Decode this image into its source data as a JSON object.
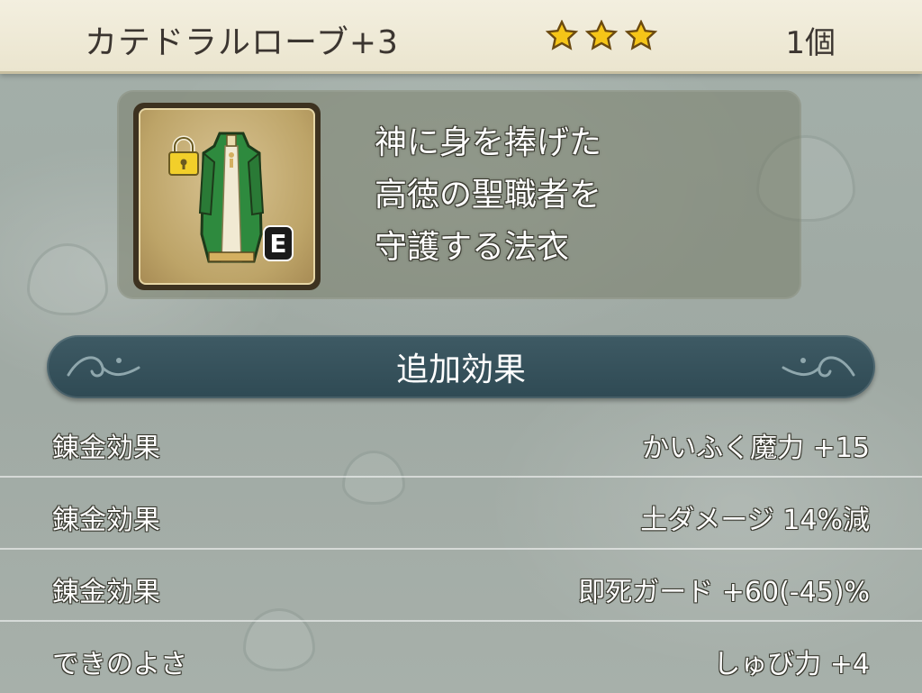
{
  "header": {
    "item_name": "カテドラルローブ+3",
    "stars": 3,
    "count": "1個"
  },
  "item": {
    "icon": "green-robe-icon",
    "locked": true,
    "equipped_badge": "E",
    "description": [
      "神に身を捧げた",
      "高徳の聖職者を",
      "守護する法衣"
    ]
  },
  "section": {
    "title": "追加効果"
  },
  "effects": [
    {
      "label": "錬金効果",
      "value": "かいふく魔力 +15"
    },
    {
      "label": "錬金効果",
      "value": "土ダメージ 14%減"
    },
    {
      "label": "錬金効果",
      "value": "即死ガード +60(-45)%"
    },
    {
      "label": "できのよさ",
      "value": "しゅび力 +4"
    }
  ],
  "colors": {
    "banner": "#2f4a54",
    "star": "#f5c518",
    "robe": "#2e8a3e"
  }
}
